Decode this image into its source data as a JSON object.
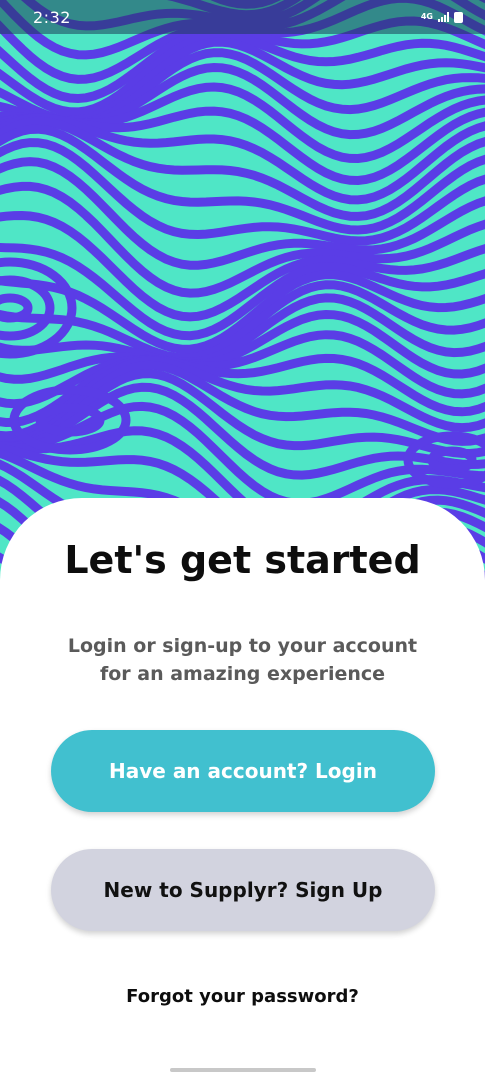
{
  "status_bar": {
    "time": "2:32",
    "network": "4G"
  },
  "hero": {
    "colors": {
      "background": "#4fe6c6",
      "stripe": "#5a3de6"
    }
  },
  "sheet": {
    "title": "Let's get started",
    "subtitle": "Login or sign-up to your account for an amazing experience",
    "login_button": "Have an account? Login",
    "signup_button": "New to Supplyr? Sign Up",
    "forgot_link": "Forgot your password?"
  },
  "colors": {
    "login_button": "#41c0cf",
    "signup_button": "#d2d3df",
    "text_primary": "#0d0d0d",
    "text_secondary": "#5a5a5a"
  }
}
